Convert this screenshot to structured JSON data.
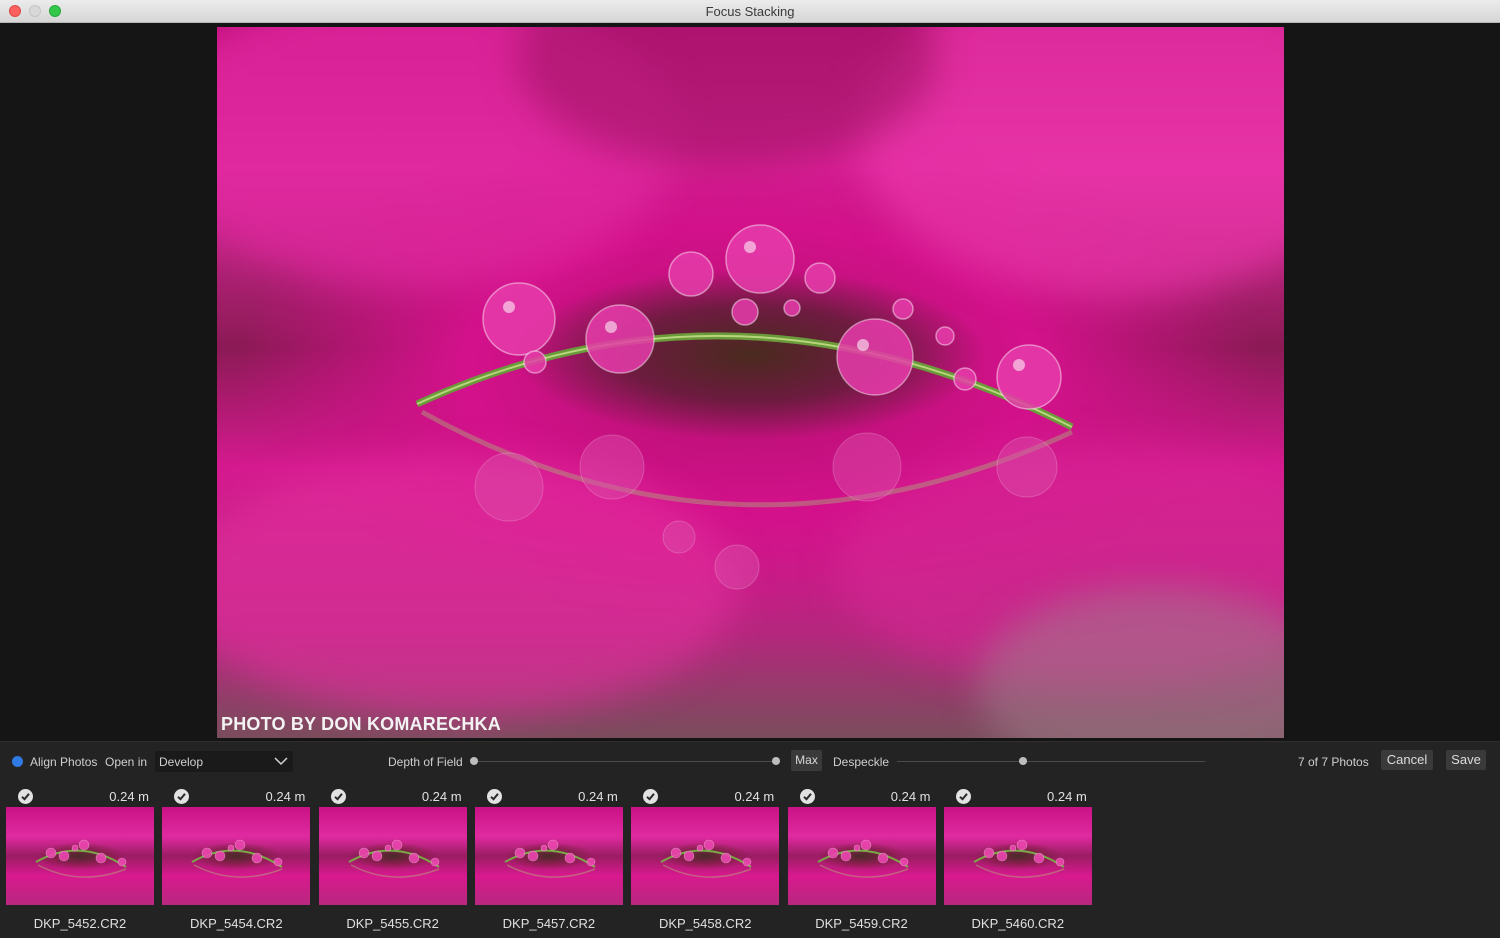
{
  "window": {
    "title": "Focus Stacking"
  },
  "preview": {
    "photo_credit": "PHOTO BY DON KOMARECHKA"
  },
  "controls": {
    "align_photos_label": "Align Photos",
    "align_photos_checked": true,
    "open_in_label": "Open in",
    "open_in_value": "Develop",
    "depth_of_field_label": "Depth of Field",
    "depth_of_field_value": 1.0,
    "max_button_label": "Max",
    "despeckle_label": "Despeckle",
    "despeckle_value": 0.41,
    "photo_count": "7 of 7 Photos",
    "cancel_label": "Cancel",
    "save_label": "Save"
  },
  "thumbnails": [
    {
      "name": "DKP_5452.CR2",
      "distance": "0.24 m",
      "checked": true
    },
    {
      "name": "DKP_5454.CR2",
      "distance": "0.24 m",
      "checked": true
    },
    {
      "name": "DKP_5455.CR2",
      "distance": "0.24 m",
      "checked": true
    },
    {
      "name": "DKP_5457.CR2",
      "distance": "0.24 m",
      "checked": true
    },
    {
      "name": "DKP_5458.CR2",
      "distance": "0.24 m",
      "checked": true
    },
    {
      "name": "DKP_5459.CR2",
      "distance": "0.24 m",
      "checked": true
    },
    {
      "name": "DKP_5460.CR2",
      "distance": "0.24 m",
      "checked": true
    }
  ],
  "colors": {
    "accent": "#2f7be3",
    "photo_magenta": "#d3118b",
    "stem_green": "#6a9a3a"
  }
}
